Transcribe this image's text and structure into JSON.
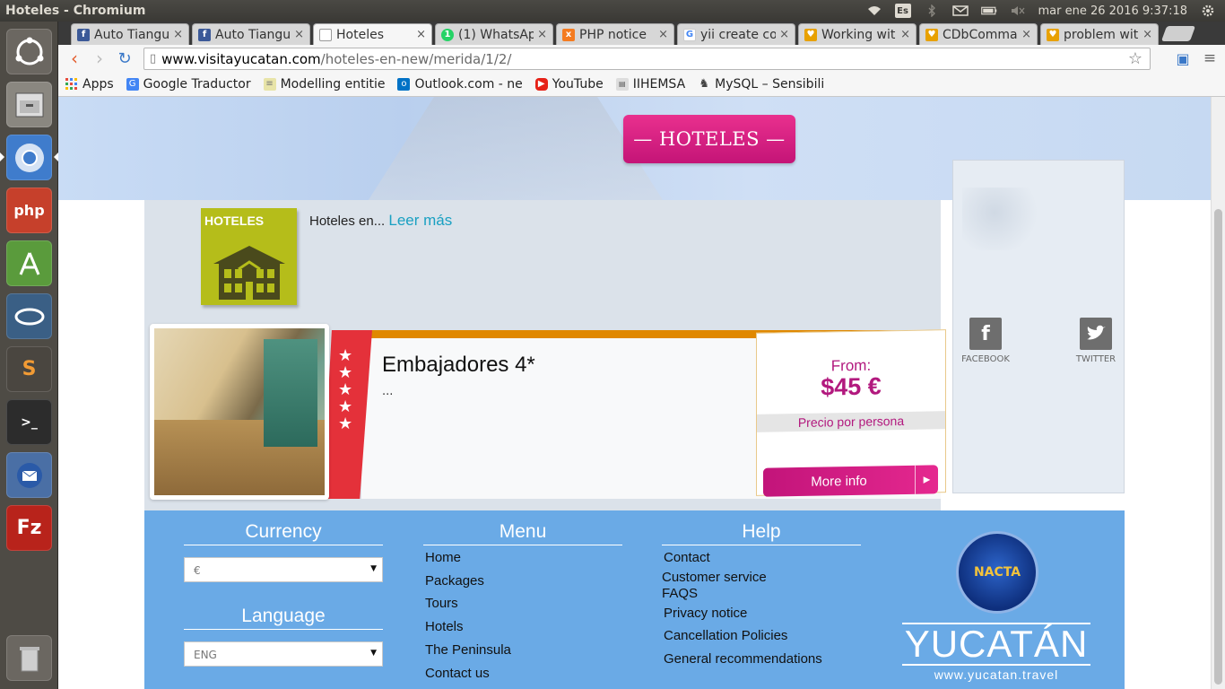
{
  "window": {
    "title": "Hoteles - Chromium"
  },
  "tray": {
    "keyboard_layout": "Es",
    "datetime": "mar ene 26 2016  9:37:18",
    "icons": [
      "wifi-icon",
      "keyboard-layout-icon",
      "bluetooth-icon",
      "mail-icon",
      "battery-icon",
      "volume-muted-icon",
      "settings-gear-icon"
    ]
  },
  "launcher": {
    "items": [
      "ubuntu-dash",
      "files",
      "chromium",
      "php",
      "android-studio",
      "app",
      "sublime-text",
      "terminal",
      "thunderbird",
      "filezilla",
      "trash"
    ]
  },
  "tabs": [
    {
      "label": "Auto Tiangu",
      "icon": "facebook-icon",
      "color": "#3b5998",
      "active": false
    },
    {
      "label": "Auto Tiangu",
      "icon": "facebook-icon",
      "color": "#3b5998",
      "active": false
    },
    {
      "label": "Hoteles",
      "icon": "page-icon",
      "color": "#ffffff",
      "active": true
    },
    {
      "label": "(1) WhatsAp",
      "icon": "whatsapp-icon",
      "color": "#25d366",
      "active": false
    },
    {
      "label": "PHP notice",
      "icon": "xampp-icon",
      "color": "#f47b20",
      "active": false
    },
    {
      "label": "yii create co",
      "icon": "google-icon",
      "color": "#4285f4",
      "active": false
    },
    {
      "label": "Working wit",
      "icon": "heart-icon",
      "color": "#e8a100",
      "active": false
    },
    {
      "label": "CDbComma",
      "icon": "heart-icon",
      "color": "#e8a100",
      "active": false
    },
    {
      "label": "problem wit",
      "icon": "heart-icon",
      "color": "#e8a100",
      "active": false
    }
  ],
  "address": {
    "host": "www.visitayucatan.com",
    "path": "/hoteles-en-new/merida/1/2/"
  },
  "bookmarks": [
    {
      "label": "Apps",
      "icon": "apps-grid-icon",
      "color": "#e74c3c"
    },
    {
      "label": "Google Traductor",
      "icon": "google-translate-icon",
      "color": "#4285f4"
    },
    {
      "label": "Modelling entitie",
      "icon": "doc-icon",
      "color": "#c7c14a"
    },
    {
      "label": "Outlook.com - ne",
      "icon": "outlook-icon",
      "color": "#0072c6"
    },
    {
      "label": "YouTube",
      "icon": "youtube-icon",
      "color": "#e62117"
    },
    {
      "label": "IIHEMSA",
      "icon": "site-icon",
      "color": "#777777"
    },
    {
      "label": "MySQL – Sensibili",
      "icon": "mysql-icon",
      "color": "#444444"
    }
  ],
  "page": {
    "hero_button": "— HOTELES —",
    "category_tile": "HOTELES",
    "intro_text": "Hoteles en...",
    "read_more": "Leer más",
    "hotel": {
      "name": "Embajadores 4*",
      "stars": 5,
      "description": "...",
      "price_from": "From:",
      "price": "$45 €",
      "price_note": "Precio por persona",
      "more_info": "More info"
    },
    "social": [
      {
        "label": "FACEBOOK",
        "icon": "facebook-icon",
        "glyph": "f"
      },
      {
        "label": "TWITTER",
        "icon": "twitter-icon",
        "glyph": "t"
      }
    ]
  },
  "footer": {
    "currency_heading": "Currency",
    "currency_value": "€",
    "language_heading": "Language",
    "language_value": "ENG",
    "menu_heading": "Menu",
    "menu_items": [
      "Home",
      "Packages",
      "Tours",
      "Hotels",
      "The Peninsula",
      "Contact us"
    ],
    "help_heading": "Help",
    "help_items": [
      "Contact",
      "Customer service",
      "FAQS",
      "Privacy notice",
      "Cancellation Policies",
      "General recommendations"
    ],
    "nacta_logo": "NACTA",
    "brand_word": "YUCATÁN",
    "brand_url": "www.yucatan.travel"
  },
  "colors": {
    "brand_magenta": "#c2147a",
    "footer_blue": "#6aaae6",
    "tile_olive": "#b5bd1a",
    "stars_red": "#e4313a",
    "accent_orange": "#e08800"
  }
}
